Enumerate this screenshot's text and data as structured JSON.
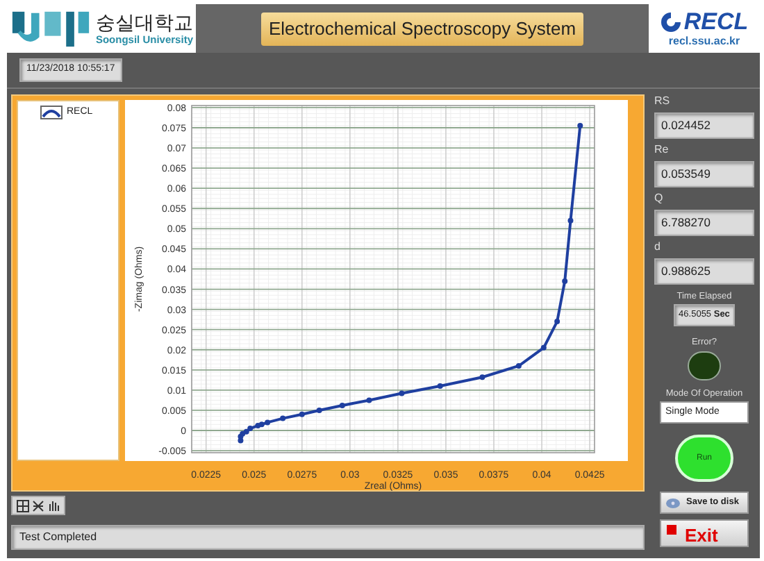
{
  "header": {
    "university_korean": "숭실대학교",
    "university_english": "Soongsil University",
    "title": "Electrochemical Spectroscopy System",
    "lab_logo": "RECL",
    "lab_url": "recl.ssu.ac.kr"
  },
  "timestamp": "11/23/2018 10:55:17",
  "graph": {
    "chart_data": {
      "type": "line",
      "grid": true,
      "xlabel": "Zreal (Ohms)",
      "ylabel": "-Zimag (Ohms)",
      "xlim": [
        0.02175,
        0.04275
      ],
      "ylim": [
        -0.0055,
        0.0805
      ],
      "xticks": [
        0.0225,
        0.025,
        0.0275,
        0.03,
        0.0325,
        0.035,
        0.0375,
        0.04,
        0.0425
      ],
      "yticks": [
        0.08,
        0.075,
        0.07,
        0.065,
        0.06,
        0.055,
        0.05,
        0.045,
        0.04,
        0.035,
        0.03,
        0.025,
        0.02,
        0.015,
        0.01,
        0.005,
        0,
        -0.005
      ],
      "x": [
        0.0243,
        0.0243,
        0.0244,
        0.0246,
        0.0248,
        0.0252,
        0.0254,
        0.0257,
        0.0265,
        0.0275,
        0.0284,
        0.0296,
        0.031,
        0.0327,
        0.0347,
        0.0369,
        0.0388,
        0.0401,
        0.0408,
        0.0412,
        0.0415,
        0.042
      ],
      "series": [
        {
          "name": "RECL",
          "color": "#1f3fa0",
          "marker": "circle",
          "values": [
            -0.0025,
            -0.0015,
            -0.0008,
            -0.0003,
            0.0005,
            0.0012,
            0.0015,
            0.002,
            0.003,
            0.004,
            0.005,
            0.0062,
            0.0075,
            0.0092,
            0.011,
            0.0132,
            0.016,
            0.0205,
            0.027,
            0.037,
            0.052,
            0.0755
          ]
        }
      ]
    }
  },
  "parameters": [
    {
      "label": "RS",
      "value": "0.024452"
    },
    {
      "label": "Re",
      "value": "0.053549"
    },
    {
      "label": "Q",
      "value": "6.788270"
    },
    {
      "label": "d",
      "value": "0.988625"
    }
  ],
  "time_elapsed": {
    "label": "Time Elapsed",
    "value": "46.5055",
    "unit": "Sec"
  },
  "error_indicator": {
    "label": "Error?",
    "on": false
  },
  "mode": {
    "label": "Mode Of Operation",
    "value": "Single Mode"
  },
  "buttons": {
    "run": "Run",
    "save": "Save to disk",
    "exit": "Exit"
  },
  "status": "Test Completed"
}
